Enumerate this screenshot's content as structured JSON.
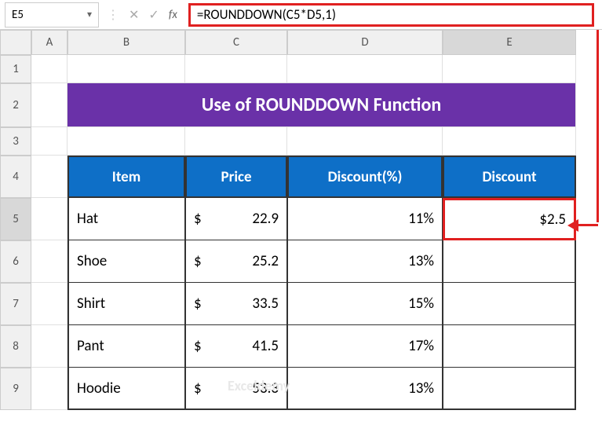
{
  "namebox": "E5",
  "formula": "=ROUNDDOWN(C5*D5,1)",
  "columns": [
    "A",
    "B",
    "C",
    "D",
    "E"
  ],
  "rows": [
    "1",
    "2",
    "3",
    "4",
    "5",
    "6",
    "7",
    "8",
    "9"
  ],
  "title": "Use of ROUNDDOWN Function",
  "headers": {
    "item": "Item",
    "price": "Price",
    "discountPct": "Discount(%)",
    "discount": "Discount"
  },
  "currency": "$",
  "table": [
    {
      "item": "Hat",
      "price": "22.9",
      "pct": "11%",
      "disc": "$2.5"
    },
    {
      "item": "Shoe",
      "price": "25.2",
      "pct": "13%",
      "disc": ""
    },
    {
      "item": "Shirt",
      "price": "33.5",
      "pct": "15%",
      "disc": ""
    },
    {
      "item": "Pant",
      "price": "41.5",
      "pct": "17%",
      "disc": ""
    },
    {
      "item": "Hoodie",
      "price": "53.3",
      "pct": "13%",
      "disc": ""
    }
  ],
  "watermark": "Exceldemy",
  "chart_data": {
    "type": "table",
    "title": "Use of ROUNDDOWN Function",
    "columns": [
      "Item",
      "Price",
      "Discount(%)",
      "Discount"
    ],
    "rows": [
      [
        "Hat",
        22.9,
        0.11,
        2.5
      ],
      [
        "Shoe",
        25.2,
        0.13,
        null
      ],
      [
        "Shirt",
        33.5,
        0.15,
        null
      ],
      [
        "Pant",
        41.5,
        0.17,
        null
      ],
      [
        "Hoodie",
        53.3,
        0.13,
        null
      ]
    ],
    "formula_cell": {
      "ref": "E5",
      "formula": "=ROUNDDOWN(C5*D5,1)"
    }
  }
}
